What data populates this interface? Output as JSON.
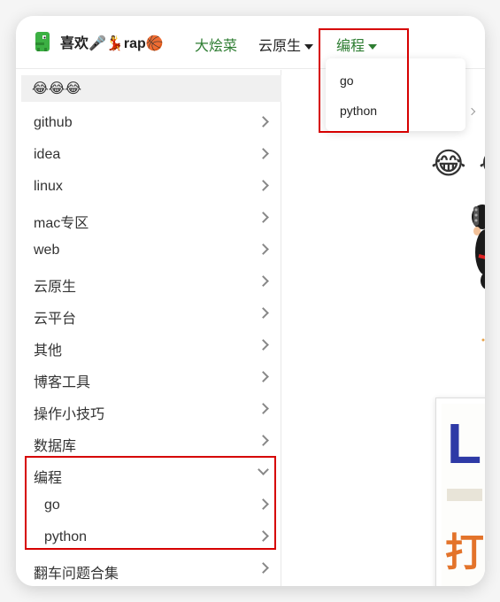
{
  "header": {
    "site_title": "喜欢🎤💃rap🏀",
    "nav": [
      {
        "label": "大烩菜"
      },
      {
        "label": "云原生"
      },
      {
        "label": "编程"
      }
    ]
  },
  "dropdown": {
    "items": [
      {
        "label": "go"
      },
      {
        "label": "python"
      }
    ]
  },
  "sidebar": {
    "top_emoji": "😂😂😂",
    "items": [
      {
        "label": "github"
      },
      {
        "label": "idea"
      },
      {
        "label": "linux"
      },
      {
        "label": "mac专区"
      },
      {
        "label": "web"
      },
      {
        "label": "云原生"
      },
      {
        "label": "云平台"
      },
      {
        "label": "其他"
      },
      {
        "label": "博客工具"
      },
      {
        "label": "操作小技巧"
      },
      {
        "label": "数据库"
      },
      {
        "label": "编程",
        "expanded": true
      },
      {
        "label": "go",
        "sub": true
      },
      {
        "label": "python",
        "sub": true
      },
      {
        "label": "翻车问题合集"
      }
    ]
  },
  "content": {
    "emoji_big": "😂",
    "banner_text": "Li",
    "banner_char": "打"
  },
  "colors": {
    "accent": "#2e7d32",
    "highlight": "#d60000"
  }
}
